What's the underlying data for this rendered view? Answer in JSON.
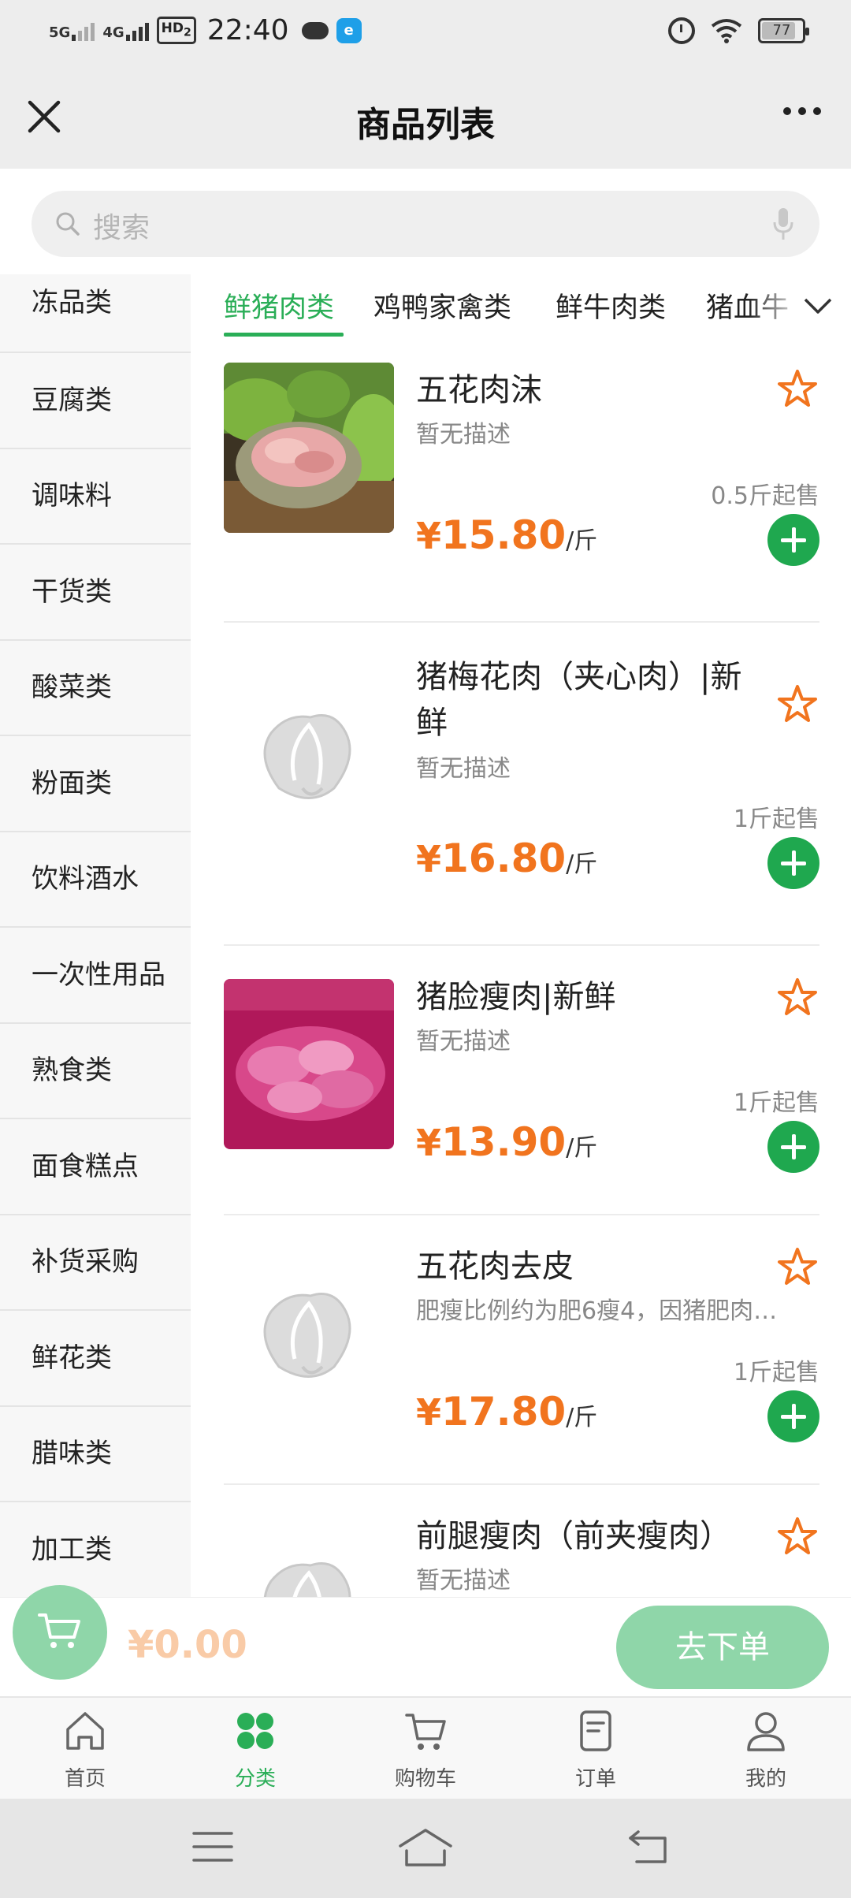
{
  "status_bar": {
    "net1": "5G",
    "net2": "4G",
    "hd": "HD",
    "hd_sub": "2",
    "time": "22:40",
    "battery": "77"
  },
  "header": {
    "title": "商品列表"
  },
  "search": {
    "placeholder": "搜索"
  },
  "sidebar": {
    "items": [
      {
        "label": "冻品类"
      },
      {
        "label": "豆腐类"
      },
      {
        "label": "调味料"
      },
      {
        "label": "干货类"
      },
      {
        "label": "酸菜类"
      },
      {
        "label": "粉面类"
      },
      {
        "label": "饮料酒水"
      },
      {
        "label": "一次性用品"
      },
      {
        "label": "熟食类"
      },
      {
        "label": "面食糕点"
      },
      {
        "label": "补货采购"
      },
      {
        "label": "鲜花类"
      },
      {
        "label": "腊味类"
      },
      {
        "label": "加工类"
      }
    ]
  },
  "tabs": {
    "items": [
      {
        "label": "鲜猪肉类"
      },
      {
        "label": "鸡鸭家禽类"
      },
      {
        "label": "鲜牛肉类"
      },
      {
        "label": "猪血牛"
      }
    ],
    "active": 0
  },
  "products": [
    {
      "name": "五花肉沫",
      "desc": "暂无描述",
      "min_qty": "0.5斤起售",
      "currency": "¥",
      "price": "15.80",
      "unit": "/斤"
    },
    {
      "name": "猪梅花肉（夹心肉）|新鲜",
      "desc": "暂无描述",
      "min_qty": "1斤起售",
      "currency": "¥",
      "price": "16.80",
      "unit": "/斤"
    },
    {
      "name": "猪脸瘦肉|新鲜",
      "desc": "暂无描述",
      "min_qty": "1斤起售",
      "currency": "¥",
      "price": "13.90",
      "unit": "/斤"
    },
    {
      "name": "五花肉去皮",
      "desc": "肥瘦比例约为肥6瘦4，因猪肥肉…",
      "min_qty": "1斤起售",
      "currency": "¥",
      "price": "17.80",
      "unit": "/斤"
    },
    {
      "name": "前腿瘦肉（前夹瘦肉）",
      "desc": "暂无描述"
    }
  ],
  "cart": {
    "total": "¥0.00",
    "checkout_label": "去下单"
  },
  "bottom_nav": {
    "items": [
      {
        "label": "首页",
        "icon": "home-icon"
      },
      {
        "label": "分类",
        "icon": "category-icon"
      },
      {
        "label": "购物车",
        "icon": "cart-icon"
      },
      {
        "label": "订单",
        "icon": "order-icon"
      },
      {
        "label": "我的",
        "icon": "profile-icon"
      }
    ],
    "active": 1
  },
  "colors": {
    "accent_green": "#2aae57",
    "price_orange": "#f1741e",
    "add_button": "#1fa84f"
  }
}
